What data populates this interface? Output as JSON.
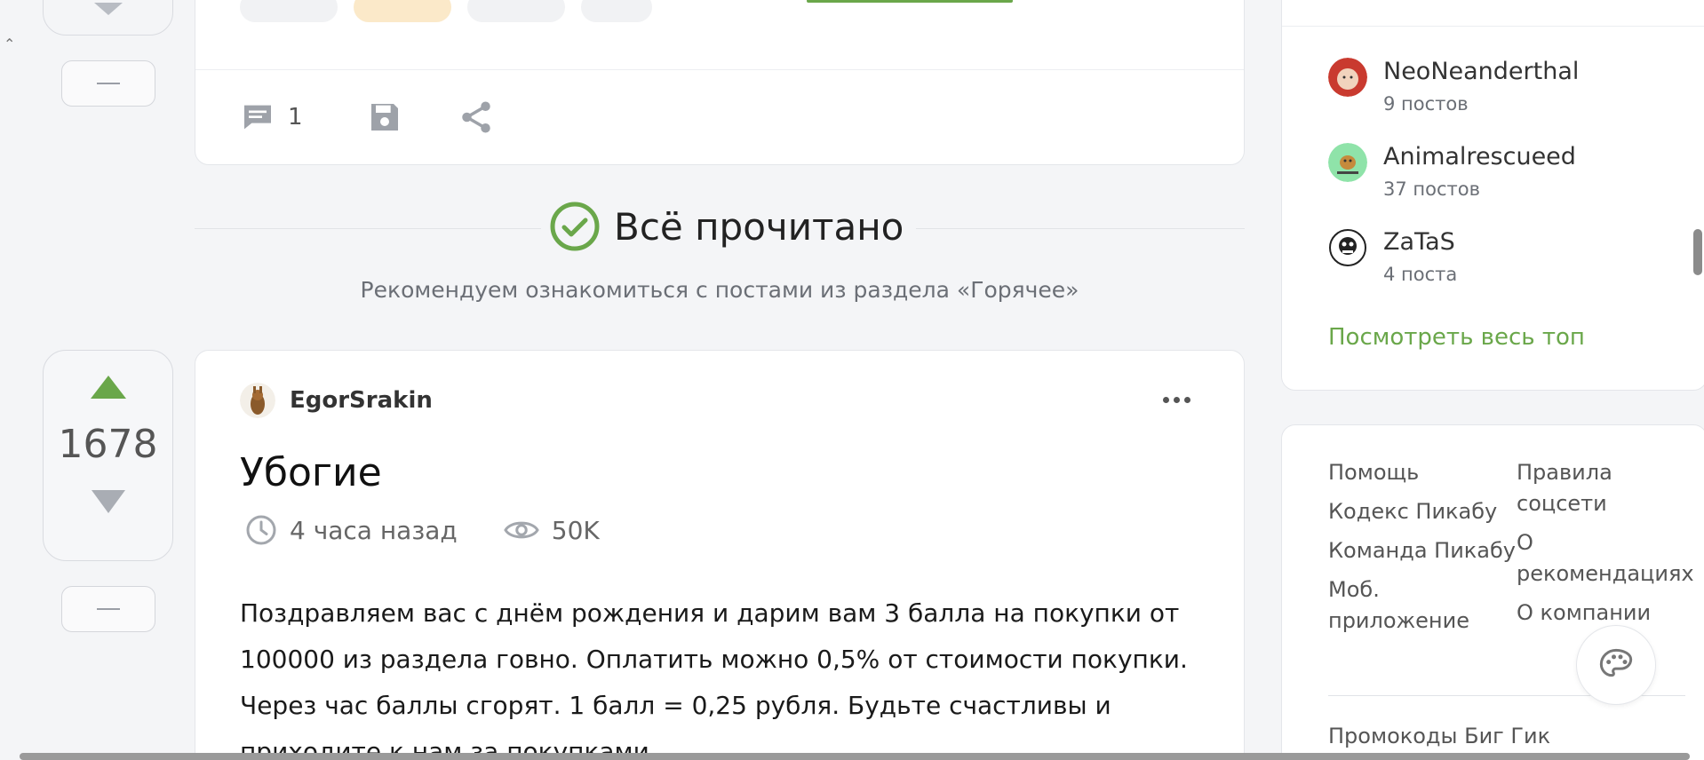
{
  "top_post": {
    "comments_count": "1"
  },
  "all_read": {
    "title": "Всё прочитано",
    "subtitle": "Рекомендуем ознакомиться с постами из раздела «Горячее»"
  },
  "post": {
    "rating": "1678",
    "author": "EgorSrakin",
    "title": "Убогие",
    "time": "4 часа назад",
    "views": "50K",
    "text": "Поздравляем вас с днём рождения и дарим вам 3 балла на покупки от 100000 из раздела говно. Оплатить можно 0,5% от стоимости покупки. Через час баллы сгорят. 1 балл = 0,25 рубля. Будьте счастливы и приходите к нам за покупками"
  },
  "sidebar": {
    "top_users": [
      {
        "name": "NeoNeanderthal",
        "count": "9 постов"
      },
      {
        "name": "Animalrescueed",
        "count": "37 постов"
      },
      {
        "name": "ZaTaS",
        "count": "4 поста"
      }
    ],
    "see_all": "Посмотреть весь топ",
    "links_col1": [
      "Помощь",
      "Кодекс Пикабу",
      "Команда Пикабу",
      "Моб. приложение"
    ],
    "links_col2": [
      "Правила соцсети",
      "О рекомендациях",
      "О компании"
    ],
    "promo": "Промокоды Биг Гик"
  },
  "colors": {
    "accent_green": "#6aa74a",
    "background": "#f4f5f7"
  }
}
